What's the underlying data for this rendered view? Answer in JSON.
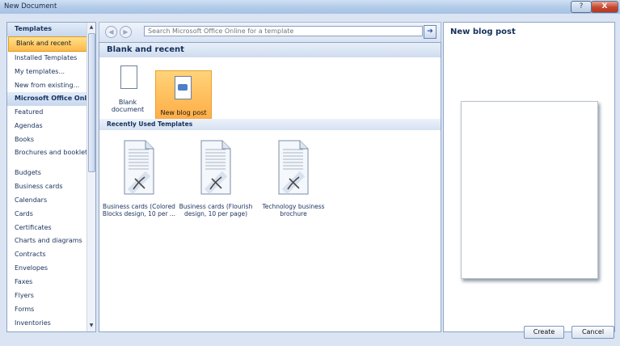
{
  "window": {
    "title": "New Document",
    "help_label": "?",
    "close_label": "X"
  },
  "categories": [
    {
      "label": "Templates",
      "kind": "header"
    },
    {
      "label": "Blank and recent",
      "kind": "selected"
    },
    {
      "label": "Installed Templates",
      "kind": "item"
    },
    {
      "label": "My templates...",
      "kind": "item"
    },
    {
      "label": "New from existing...",
      "kind": "item"
    },
    {
      "label": "Microsoft Office Online",
      "kind": "header"
    },
    {
      "label": "Featured",
      "kind": "item"
    },
    {
      "label": "Agendas",
      "kind": "item"
    },
    {
      "label": "Books",
      "kind": "item"
    },
    {
      "label": "Brochures and booklets",
      "kind": "twoline"
    },
    {
      "label": "Budgets",
      "kind": "item"
    },
    {
      "label": "Business cards",
      "kind": "item"
    },
    {
      "label": "Calendars",
      "kind": "item"
    },
    {
      "label": "Cards",
      "kind": "item"
    },
    {
      "label": "Certificates",
      "kind": "item"
    },
    {
      "label": "Charts and diagrams",
      "kind": "item"
    },
    {
      "label": "Contracts",
      "kind": "item"
    },
    {
      "label": "Envelopes",
      "kind": "item"
    },
    {
      "label": "Faxes",
      "kind": "item"
    },
    {
      "label": "Flyers",
      "kind": "item"
    },
    {
      "label": "Forms",
      "kind": "item"
    },
    {
      "label": "Inventories",
      "kind": "item"
    }
  ],
  "search": {
    "placeholder": "Search Microsoft Office Online for a template",
    "back_icon": "back-arrow-icon",
    "forward_icon": "forward-arrow-icon",
    "go_icon": "go-arrow-icon"
  },
  "main": {
    "section_title": "Blank and recent",
    "tiles": [
      {
        "label": "Blank document",
        "selected": false
      },
      {
        "label": "New blog post",
        "selected": true
      }
    ],
    "recent_title": "Recently Used Templates",
    "recent": [
      {
        "label": "Business cards (Colored Blocks design, 10 per ..."
      },
      {
        "label": "Business cards (Flourish design, 10 per page)"
      },
      {
        "label": "Technology business brochure"
      }
    ]
  },
  "preview": {
    "title": "New blog post"
  },
  "buttons": {
    "create": "Create",
    "cancel": "Cancel"
  },
  "colors": {
    "selection": "#ffb94a",
    "header_text": "#13305b",
    "frame": "#dae4f3"
  }
}
